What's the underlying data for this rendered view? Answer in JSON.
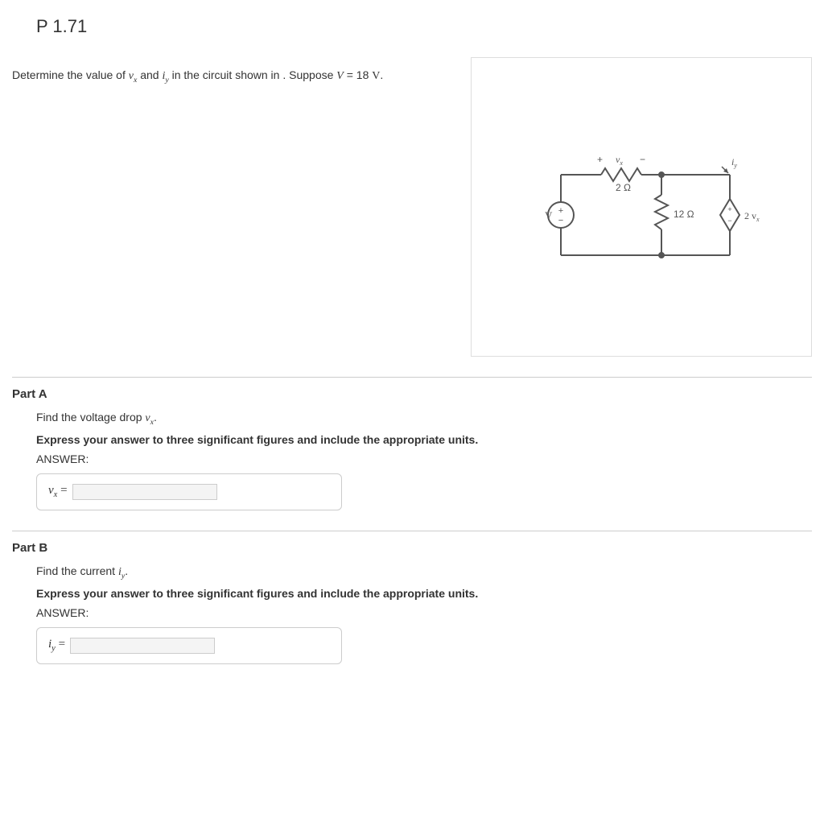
{
  "title": "P 1.71",
  "statement_pre": "Determine the value of ",
  "statement_var1_base": "v",
  "statement_var1_sub": "x",
  "statement_mid1": " and ",
  "statement_var2_base": "i",
  "statement_var2_sub": "y",
  "statement_mid2": " in the circuit shown in . Suppose ",
  "statement_var3": "V",
  "statement_eq": " = 18 ",
  "statement_unit": "V",
  "statement_end": ".",
  "circuit": {
    "v_source": "V",
    "vx_plus": "+",
    "vx_label_base": "v",
    "vx_label_sub": "x",
    "vx_minus": "−",
    "r1": "2 Ω",
    "r2": "12 Ω",
    "iy_base": "i",
    "iy_sub": "y",
    "dep_label": "2 v",
    "dep_label_sub": "x",
    "src_plus": "+",
    "src_minus": "−"
  },
  "partA": {
    "heading": "Part A",
    "line1_pre": "Find the voltage drop ",
    "line1_var_base": "v",
    "line1_var_sub": "x",
    "line1_post": ".",
    "instruction": "Express your answer to three significant figures and include the appropriate units.",
    "answer_label": "ANSWER:",
    "input_label_base": "v",
    "input_label_sub": "x",
    "input_label_eq": " = "
  },
  "partB": {
    "heading": "Part B",
    "line1_pre": "Find the current ",
    "line1_var_base": "i",
    "line1_var_sub": "y",
    "line1_post": ".",
    "instruction": "Express your answer to three significant figures and include the appropriate units.",
    "answer_label": "ANSWER:",
    "input_label_base": "i",
    "input_label_sub": "y",
    "input_label_eq": " = "
  }
}
